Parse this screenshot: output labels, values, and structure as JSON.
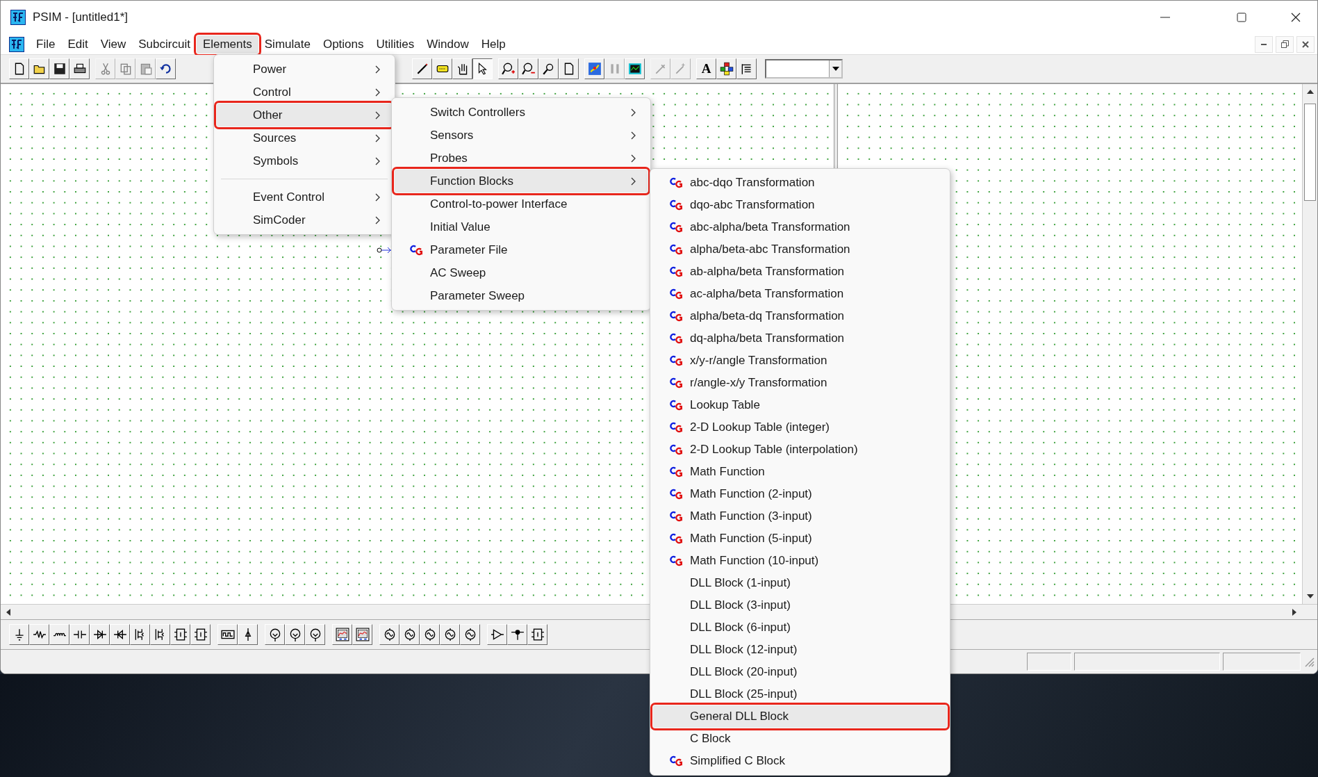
{
  "window": {
    "title": "PSIM - [untitled1*]"
  },
  "menu_bar": [
    {
      "label": "File",
      "selected": false,
      "highlighted": false
    },
    {
      "label": "Edit",
      "selected": false,
      "highlighted": false
    },
    {
      "label": "View",
      "selected": false,
      "highlighted": false
    },
    {
      "label": "Subcircuit",
      "selected": false,
      "highlighted": false
    },
    {
      "label": "Elements",
      "selected": true,
      "highlighted": true
    },
    {
      "label": "Simulate",
      "selected": false,
      "highlighted": false
    },
    {
      "label": "Options",
      "selected": false,
      "highlighted": false
    },
    {
      "label": "Utilities",
      "selected": false,
      "highlighted": false
    },
    {
      "label": "Window",
      "selected": false,
      "highlighted": false
    },
    {
      "label": "Help",
      "selected": false,
      "highlighted": false
    }
  ],
  "toolbar": [
    [
      {
        "kind": "new",
        "disabled": false,
        "pressed": false
      },
      {
        "kind": "open",
        "disabled": false,
        "pressed": false
      },
      {
        "kind": "save",
        "disabled": false,
        "pressed": false
      },
      {
        "kind": "print",
        "disabled": false,
        "pressed": false
      }
    ],
    [
      {
        "kind": "cut",
        "disabled": true,
        "pressed": false
      },
      {
        "kind": "copy",
        "disabled": true,
        "pressed": false
      },
      {
        "kind": "paste",
        "disabled": true,
        "pressed": false
      },
      {
        "kind": "undo",
        "disabled": false,
        "pressed": false
      }
    ],
    [
      {
        "kind": "pencil",
        "disabled": false,
        "pressed": false
      },
      {
        "kind": "tag",
        "disabled": false,
        "pressed": false
      },
      {
        "kind": "hand",
        "disabled": false,
        "pressed": false
      },
      {
        "kind": "pointer",
        "disabled": false,
        "pressed": true
      }
    ],
    [
      {
        "kind": "zoom-in",
        "disabled": false,
        "pressed": false
      },
      {
        "kind": "zoom-out",
        "disabled": false,
        "pressed": false
      },
      {
        "kind": "zoom-fit",
        "disabled": false,
        "pressed": false
      },
      {
        "kind": "page",
        "disabled": false,
        "pressed": false
      }
    ],
    [
      {
        "kind": "run",
        "disabled": false,
        "pressed": false
      },
      {
        "kind": "pause",
        "disabled": true,
        "pressed": false
      },
      {
        "kind": "scope",
        "disabled": false,
        "pressed": false
      }
    ],
    [
      {
        "kind": "wire-tool",
        "disabled": true,
        "pressed": false
      },
      {
        "kind": "wire-plus",
        "disabled": true,
        "pressed": false
      }
    ],
    [
      {
        "kind": "text",
        "label": "A",
        "disabled": false,
        "pressed": false
      },
      {
        "kind": "colors",
        "disabled": false,
        "pressed": false
      },
      {
        "kind": "list",
        "disabled": false,
        "pressed": false
      }
    ]
  ],
  "component_toolbar": [
    [
      {
        "kind": "ground"
      },
      {
        "kind": "resistor"
      },
      {
        "kind": "inductor"
      },
      {
        "kind": "capacitor"
      },
      {
        "kind": "diode"
      },
      {
        "kind": "diode-reverse"
      },
      {
        "kind": "transistor"
      },
      {
        "kind": "transistor"
      },
      {
        "kind": "module"
      },
      {
        "kind": "module"
      }
    ],
    [
      {
        "kind": "pulse"
      },
      {
        "kind": "probe"
      }
    ],
    [
      {
        "kind": "meter"
      },
      {
        "kind": "meter"
      },
      {
        "kind": "meter"
      }
    ],
    [
      {
        "kind": "scope"
      },
      {
        "kind": "scope"
      }
    ],
    [
      {
        "kind": "source"
      },
      {
        "kind": "source"
      },
      {
        "kind": "source"
      },
      {
        "kind": "source"
      },
      {
        "kind": "source"
      }
    ],
    [
      {
        "kind": "amplifier"
      },
      {
        "kind": "node"
      },
      {
        "kind": "module"
      }
    ]
  ],
  "menus": [
    {
      "items": [
        {
          "kind": "item",
          "label": "Power",
          "submenu": true,
          "selected": false,
          "highlighted": false,
          "has_icon": false
        },
        {
          "kind": "item",
          "label": "Control",
          "submenu": true,
          "selected": false,
          "highlighted": false,
          "has_icon": false
        },
        {
          "kind": "item",
          "label": "Other",
          "submenu": true,
          "selected": true,
          "highlighted": true,
          "has_icon": false
        },
        {
          "kind": "item",
          "label": "Sources",
          "submenu": true,
          "selected": false,
          "highlighted": false,
          "has_icon": false
        },
        {
          "kind": "item",
          "label": "Symbols",
          "submenu": true,
          "selected": false,
          "highlighted": false,
          "has_icon": false
        },
        {
          "kind": "separator"
        },
        {
          "kind": "item",
          "label": "Event Control",
          "submenu": true,
          "selected": false,
          "highlighted": false,
          "has_icon": false
        },
        {
          "kind": "item",
          "label": "SimCoder",
          "submenu": true,
          "selected": false,
          "highlighted": false,
          "has_icon": false
        }
      ]
    },
    {
      "items": [
        {
          "kind": "item",
          "label": "Switch Controllers",
          "submenu": true,
          "selected": false,
          "highlighted": false,
          "has_icon": false
        },
        {
          "kind": "item",
          "label": "Sensors",
          "submenu": true,
          "selected": false,
          "highlighted": false,
          "has_icon": false
        },
        {
          "kind": "item",
          "label": "Probes",
          "submenu": true,
          "selected": false,
          "highlighted": false,
          "has_icon": false
        },
        {
          "kind": "item",
          "label": "Function Blocks",
          "submenu": true,
          "selected": true,
          "highlighted": true,
          "has_icon": false
        },
        {
          "kind": "item",
          "label": "Control-to-power Interface",
          "submenu": false,
          "selected": false,
          "highlighted": false,
          "has_icon": false
        },
        {
          "kind": "item",
          "label": "Initial Value",
          "submenu": false,
          "selected": false,
          "highlighted": false,
          "has_icon": false
        },
        {
          "kind": "item",
          "label": "Parameter File",
          "submenu": false,
          "selected": false,
          "highlighted": false,
          "has_icon": true
        },
        {
          "kind": "item",
          "label": "AC Sweep",
          "submenu": false,
          "selected": false,
          "highlighted": false,
          "has_icon": false
        },
        {
          "kind": "item",
          "label": "Parameter Sweep",
          "submenu": false,
          "selected": false,
          "highlighted": false,
          "has_icon": false
        }
      ]
    },
    {
      "items": [
        {
          "kind": "item",
          "label": "abc-dqo Transformation",
          "submenu": false,
          "selected": false,
          "highlighted": false,
          "has_icon": true
        },
        {
          "kind": "item",
          "label": "dqo-abc Transformation",
          "submenu": false,
          "selected": false,
          "highlighted": false,
          "has_icon": true
        },
        {
          "kind": "item",
          "label": "abc-alpha/beta Transformation",
          "submenu": false,
          "selected": false,
          "highlighted": false,
          "has_icon": true
        },
        {
          "kind": "item",
          "label": "alpha/beta-abc Transformation",
          "submenu": false,
          "selected": false,
          "highlighted": false,
          "has_icon": true
        },
        {
          "kind": "item",
          "label": "ab-alpha/beta Transformation",
          "submenu": false,
          "selected": false,
          "highlighted": false,
          "has_icon": true
        },
        {
          "kind": "item",
          "label": "ac-alpha/beta Transformation",
          "submenu": false,
          "selected": false,
          "highlighted": false,
          "has_icon": true
        },
        {
          "kind": "item",
          "label": "alpha/beta-dq Transformation",
          "submenu": false,
          "selected": false,
          "highlighted": false,
          "has_icon": true
        },
        {
          "kind": "item",
          "label": "dq-alpha/beta Transformation",
          "submenu": false,
          "selected": false,
          "highlighted": false,
          "has_icon": true
        },
        {
          "kind": "item",
          "label": "x/y-r/angle Transformation",
          "submenu": false,
          "selected": false,
          "highlighted": false,
          "has_icon": true
        },
        {
          "kind": "item",
          "label": "r/angle-x/y Transformation",
          "submenu": false,
          "selected": false,
          "highlighted": false,
          "has_icon": true
        },
        {
          "kind": "item",
          "label": "Lookup Table",
          "submenu": false,
          "selected": false,
          "highlighted": false,
          "has_icon": true
        },
        {
          "kind": "item",
          "label": "2-D Lookup Table (integer)",
          "submenu": false,
          "selected": false,
          "highlighted": false,
          "has_icon": true
        },
        {
          "kind": "item",
          "label": "2-D Lookup Table (interpolation)",
          "submenu": false,
          "selected": false,
          "highlighted": false,
          "has_icon": true
        },
        {
          "kind": "item",
          "label": "Math Function",
          "submenu": false,
          "selected": false,
          "highlighted": false,
          "has_icon": true
        },
        {
          "kind": "item",
          "label": "Math Function (2-input)",
          "submenu": false,
          "selected": false,
          "highlighted": false,
          "has_icon": true
        },
        {
          "kind": "item",
          "label": "Math Function (3-input)",
          "submenu": false,
          "selected": false,
          "highlighted": false,
          "has_icon": true
        },
        {
          "kind": "item",
          "label": "Math Function (5-input)",
          "submenu": false,
          "selected": false,
          "highlighted": false,
          "has_icon": true
        },
        {
          "kind": "item",
          "label": "Math Function (10-input)",
          "submenu": false,
          "selected": false,
          "highlighted": false,
          "has_icon": true
        },
        {
          "kind": "item",
          "label": "DLL Block (1-input)",
          "submenu": false,
          "selected": false,
          "highlighted": false,
          "has_icon": false
        },
        {
          "kind": "item",
          "label": "DLL Block (3-input)",
          "submenu": false,
          "selected": false,
          "highlighted": false,
          "has_icon": false
        },
        {
          "kind": "item",
          "label": "DLL Block (6-input)",
          "submenu": false,
          "selected": false,
          "highlighted": false,
          "has_icon": false
        },
        {
          "kind": "item",
          "label": "DLL Block (12-input)",
          "submenu": false,
          "selected": false,
          "highlighted": false,
          "has_icon": false
        },
        {
          "kind": "item",
          "label": "DLL Block (20-input)",
          "submenu": false,
          "selected": false,
          "highlighted": false,
          "has_icon": false
        },
        {
          "kind": "item",
          "label": "DLL Block (25-input)",
          "submenu": false,
          "selected": false,
          "highlighted": false,
          "has_icon": false
        },
        {
          "kind": "item",
          "label": "General DLL Block",
          "submenu": false,
          "selected": true,
          "highlighted": true,
          "has_icon": false
        },
        {
          "kind": "item",
          "label": "C Block",
          "submenu": false,
          "selected": false,
          "highlighted": false,
          "has_icon": false
        },
        {
          "kind": "item",
          "label": "Simplified C Block",
          "submenu": false,
          "selected": false,
          "highlighted": false,
          "has_icon": true
        }
      ]
    }
  ]
}
